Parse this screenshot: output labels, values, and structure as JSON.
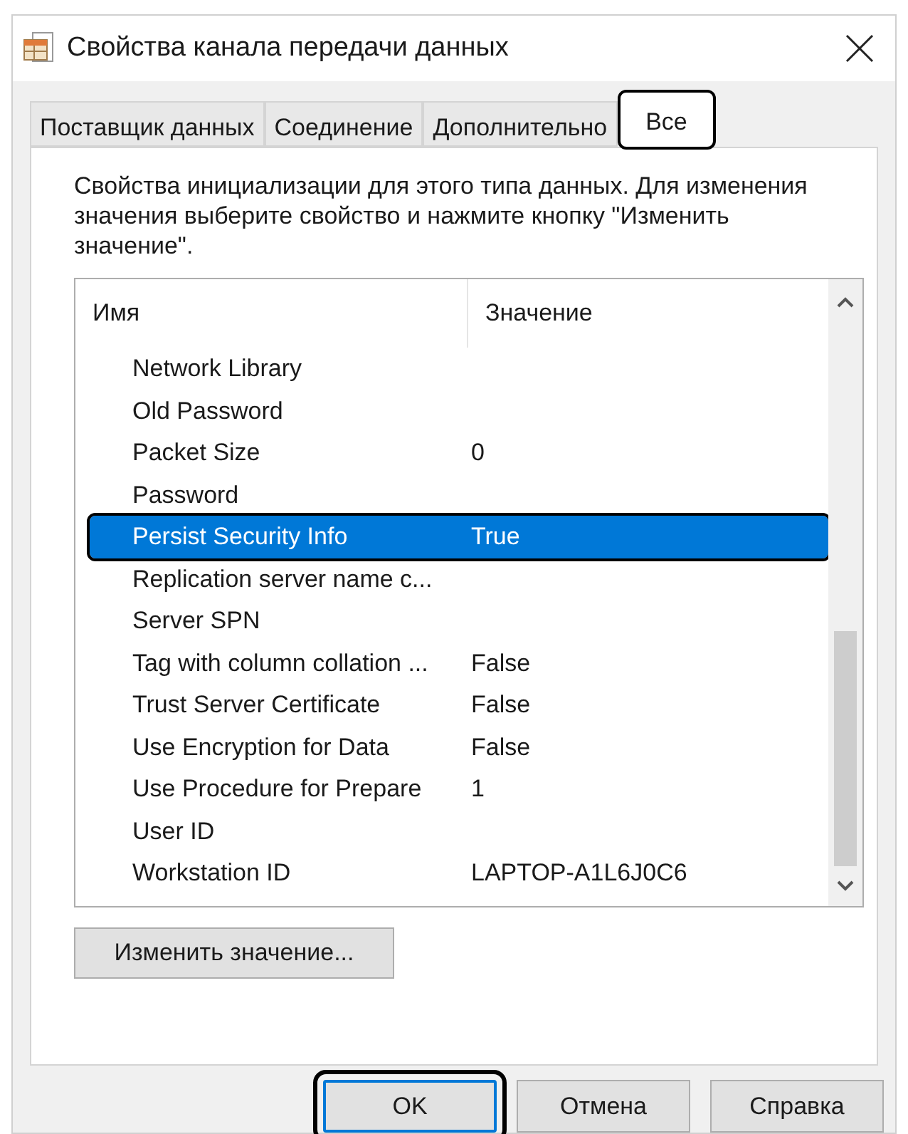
{
  "window": {
    "title": "Свойства канала передачи данных"
  },
  "tabs": [
    {
      "label": "Поставщик данных",
      "selected": false
    },
    {
      "label": "Соединение",
      "selected": false
    },
    {
      "label": "Дополнительно",
      "selected": false
    },
    {
      "label": "Все",
      "selected": true
    }
  ],
  "description": "Свойства инициализации для этого типа данных. Для изменения значения выберите свойство и нажмите кнопку \"Изменить значение\".",
  "table": {
    "columns": [
      "Имя",
      "Значение"
    ],
    "rows": [
      {
        "name": "Network Library",
        "value": "",
        "selected": false
      },
      {
        "name": "Old Password",
        "value": "",
        "selected": false
      },
      {
        "name": "Packet Size",
        "value": "0",
        "selected": false
      },
      {
        "name": "Password",
        "value": "",
        "selected": false
      },
      {
        "name": "Persist Security Info",
        "value": "True",
        "selected": true
      },
      {
        "name": "Replication server name c...",
        "value": "",
        "selected": false
      },
      {
        "name": "Server SPN",
        "value": "",
        "selected": false
      },
      {
        "name": "Tag with column collation ...",
        "value": "False",
        "selected": false
      },
      {
        "name": "Trust Server Certificate",
        "value": "False",
        "selected": false
      },
      {
        "name": "Use Encryption for Data",
        "value": "False",
        "selected": false
      },
      {
        "name": "Use Procedure for Prepare",
        "value": "1",
        "selected": false
      },
      {
        "name": "User ID",
        "value": "",
        "selected": false
      },
      {
        "name": "Workstation ID",
        "value": "LAPTOP-A1L6J0C6",
        "selected": false
      }
    ]
  },
  "edit_button": "Изменить значение...",
  "buttons": [
    {
      "label": "OK",
      "default": true
    },
    {
      "label": "Отмена",
      "default": false
    },
    {
      "label": "Справка",
      "default": false
    }
  ]
}
